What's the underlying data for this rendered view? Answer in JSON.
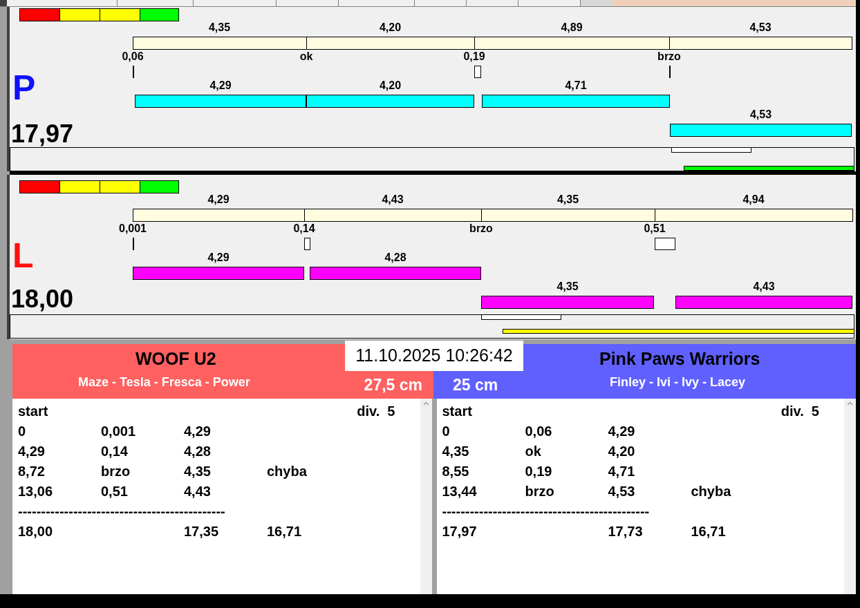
{
  "lanes": [
    {
      "letter": "P",
      "color": "#1010ff",
      "total": "17,97",
      "run_bars": {
        "color": "#00ffff"
      },
      "time_marker": {
        "color": "#00ff00"
      },
      "segments": [
        {
          "time": "4,35",
          "mark": "0,06"
        },
        {
          "time": "4,20",
          "mark": "ok"
        },
        {
          "time": "4,89",
          "mark": "0,19"
        },
        {
          "time": "4,53",
          "mark": "brzo"
        }
      ],
      "runs_row_1": [
        "4,29",
        "4,20",
        "4,71"
      ],
      "runs_row_2": [
        "4,53"
      ]
    },
    {
      "letter": "L",
      "color": "#ff1010",
      "total": "18,00",
      "run_bars": {
        "color": "#ff00ff"
      },
      "time_marker": {
        "color": "#ffff00"
      },
      "segments": [
        {
          "time": "4,29",
          "mark": "0,001"
        },
        {
          "time": "4,43",
          "mark": "0,14"
        },
        {
          "time": "4,35",
          "mark": "brzo"
        },
        {
          "time": "4,94",
          "mark": "0,51"
        }
      ],
      "runs_row_1": [
        "4,29",
        "4,28"
      ],
      "runs_row_2": [
        "4,35",
        "4,43"
      ]
    }
  ],
  "timestamp": "11.10.2025 10:26:42",
  "teams": [
    {
      "name": "WOOF U2",
      "dogs": "Maze - Tesla - Fresca - Power",
      "height": "27,5 cm",
      "color": "#ff6060",
      "header": {
        "left": "start",
        "right": "div.  5"
      },
      "rows": [
        {
          "column_1": "0",
          "column_2": "0,001",
          "column_3": "4,29"
        },
        {
          "column_1": "4,29",
          "column_2": "0,14",
          "column_3": "4,28"
        },
        {
          "column_1": "8,72",
          "column_2": "brzo",
          "column_3": "4,35",
          "column_4": "chyba"
        },
        {
          "column_1": "13,06",
          "column_2": "0,51",
          "column_3": "4,43"
        },
        {
          "column_1": "---------------------------------------------"
        },
        {
          "column_1": "18,00",
          "column_3": "17,35",
          "column_4": "16,71"
        }
      ]
    },
    {
      "name": "Pink Paws Warriors",
      "dogs": "Finley - Ivi - Ivy - Lacey",
      "height": "25 cm",
      "color": "#6060ff",
      "header": {
        "left": "start",
        "right": "div.  5"
      },
      "rows": [
        {
          "column_1": "0",
          "column_2": "0,06",
          "column_3": "4,29"
        },
        {
          "column_1": "4,35",
          "column_2": "ok",
          "column_3": "4,20"
        },
        {
          "column_1": "8,55",
          "column_2": "0,19",
          "column_3": "4,71"
        },
        {
          "column_1": "13,44",
          "column_2": "brzo",
          "column_3": "4,53",
          "column_4": "chyba"
        },
        {
          "column_1": "---------------------------------------------"
        },
        {
          "column_1": "17,97",
          "column_3": "17,73",
          "column_4": "16,71"
        }
      ]
    }
  ]
}
